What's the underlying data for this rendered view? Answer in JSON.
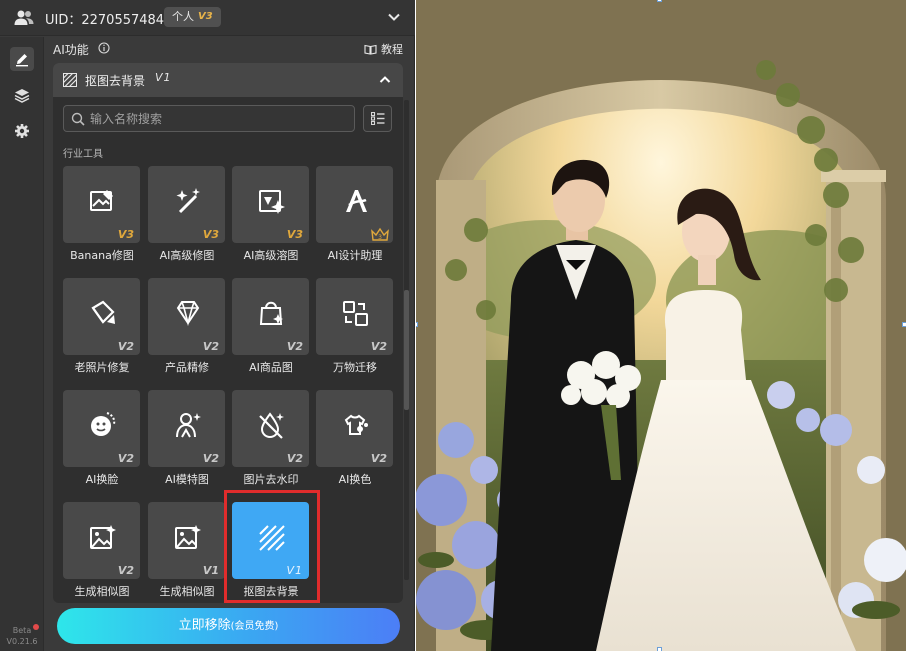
{
  "topbar": {
    "uid": "UID：2270557484",
    "plan_label": "个人",
    "plan_version": "V3"
  },
  "header": {
    "title": "AI功能",
    "tutorial": "教程"
  },
  "tool_select": {
    "name": "抠图去背景",
    "version": "V1"
  },
  "search": {
    "placeholder": "输入名称搜索"
  },
  "section_label": "行业工具",
  "tools": [
    {
      "label": "Banana修图",
      "version": "V3",
      "icon": "image-edit-icon"
    },
    {
      "label": "AI高级修图",
      "version": "V3",
      "icon": "magic-wand-icon"
    },
    {
      "label": "AI高级溶图",
      "version": "V3",
      "icon": "image-blend-icon"
    },
    {
      "label": "AI设计助理",
      "version": "",
      "icon": "design-assistant-icon"
    },
    {
      "label": "老照片修复",
      "version": "V2",
      "icon": "photo-repair-icon"
    },
    {
      "label": "产品精修",
      "version": "V2",
      "icon": "diamond-icon"
    },
    {
      "label": "AI商品图",
      "version": "V2",
      "icon": "shopping-bag-icon"
    },
    {
      "label": "万物迁移",
      "version": "V2",
      "icon": "transfer-icon"
    },
    {
      "label": "AI换脸",
      "version": "V2",
      "icon": "face-swap-icon"
    },
    {
      "label": "AI模特图",
      "version": "V2",
      "icon": "model-icon"
    },
    {
      "label": "图片去水印",
      "version": "V2",
      "icon": "remove-watermark-icon"
    },
    {
      "label": "AI换色",
      "version": "V2",
      "icon": "palette-icon"
    },
    {
      "label": "生成相似图",
      "version": "V2",
      "icon": "similar-image-icon"
    },
    {
      "label": "生成相似图",
      "version": "V1",
      "icon": "similar-image-icon"
    },
    {
      "label": "抠图去背景",
      "version": "V1",
      "icon": "cutout-icon"
    }
  ],
  "cta": {
    "label": "立即移除",
    "sub": "(会员免费)"
  },
  "beta": {
    "label": "Beta",
    "version": "V0.21.6"
  },
  "colors": {
    "panel_bg": "#3a3a3a",
    "tile_bg": "#494949",
    "selected": "#3fa8f4",
    "highlight": "#e12c2c",
    "gold": "#e0a83c"
  }
}
